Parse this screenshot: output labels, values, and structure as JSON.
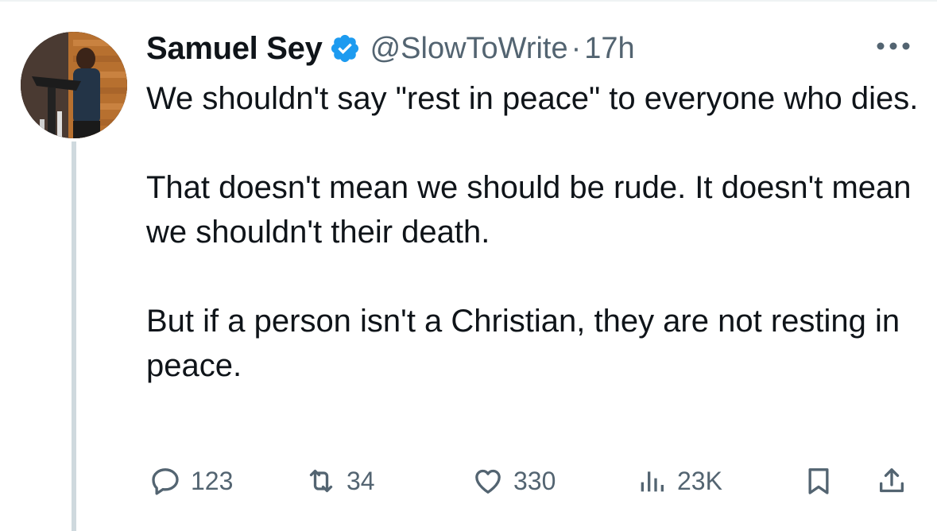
{
  "tweet": {
    "author_name": "Samuel Sey",
    "handle": "@SlowToWrite",
    "separator": "·",
    "time": "17h",
    "paragraphs": [
      "We shouldn't say \"rest in peace\" to everyone who dies.",
      "That doesn't mean we should be rude. It doesn't mean we shouldn't their death.",
      "But if a person isn't a Christian, they are not resting in peace."
    ]
  },
  "metrics": {
    "replies": "123",
    "reposts": "34",
    "likes": "330",
    "views": "23K"
  },
  "icons": {
    "verified": "verified-badge-icon",
    "more": "more-dots-icon",
    "reply": "reply-icon",
    "repost": "repost-icon",
    "like": "heart-icon",
    "views": "views-icon",
    "bookmark": "bookmark-icon",
    "share": "share-icon"
  },
  "colors": {
    "text": "#0f1419",
    "secondary": "#536471",
    "verified": "#1d9bf0",
    "thread_line": "#cfd9de"
  }
}
